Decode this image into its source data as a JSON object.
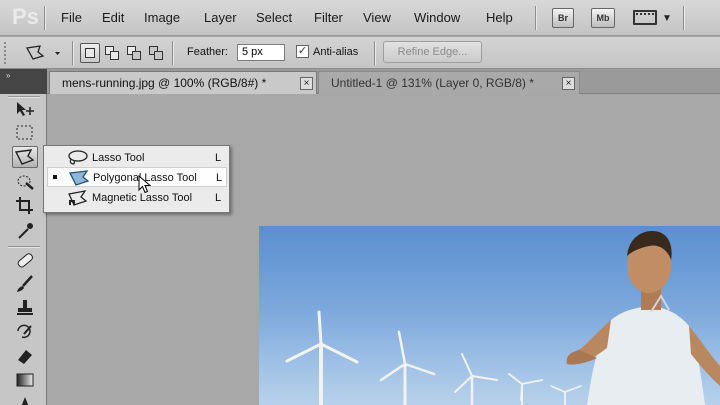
{
  "app": {
    "logo": "Ps"
  },
  "menu": [
    "File",
    "Edit",
    "Image",
    "Layer",
    "Select",
    "Filter",
    "View",
    "Window",
    "Help"
  ],
  "app_buttons": [
    "Br",
    "Mb"
  ],
  "options": {
    "feather_label": "Feather:",
    "feather_value": "5 px",
    "antialias_label": "Anti-alias",
    "antialias_checked": true,
    "refine_edge_label": "Refine Edge..."
  },
  "tabs": [
    {
      "label": "mens-running.jpg @ 100% (RGB/8#) *",
      "active": true,
      "close": "×"
    },
    {
      "label": "Untitled-1 @ 131% (Layer 0, RGB/8) *",
      "active": false,
      "close": "×"
    }
  ],
  "panel_collapse": "»",
  "flyout": {
    "items": [
      {
        "label": "Lasso Tool",
        "shortcut": "L",
        "icon": "lasso-icon",
        "current": false
      },
      {
        "label": "Polygonal Lasso Tool",
        "shortcut": "L",
        "icon": "polygonal-lasso-icon",
        "current": true
      },
      {
        "label": "Magnetic Lasso Tool",
        "shortcut": "L",
        "icon": "magnetic-lasso-icon",
        "current": false
      }
    ]
  },
  "colors": {
    "menubar": "#c4c4c4",
    "workspace": "#a8a8a8",
    "sky": "#5a8fcf"
  }
}
